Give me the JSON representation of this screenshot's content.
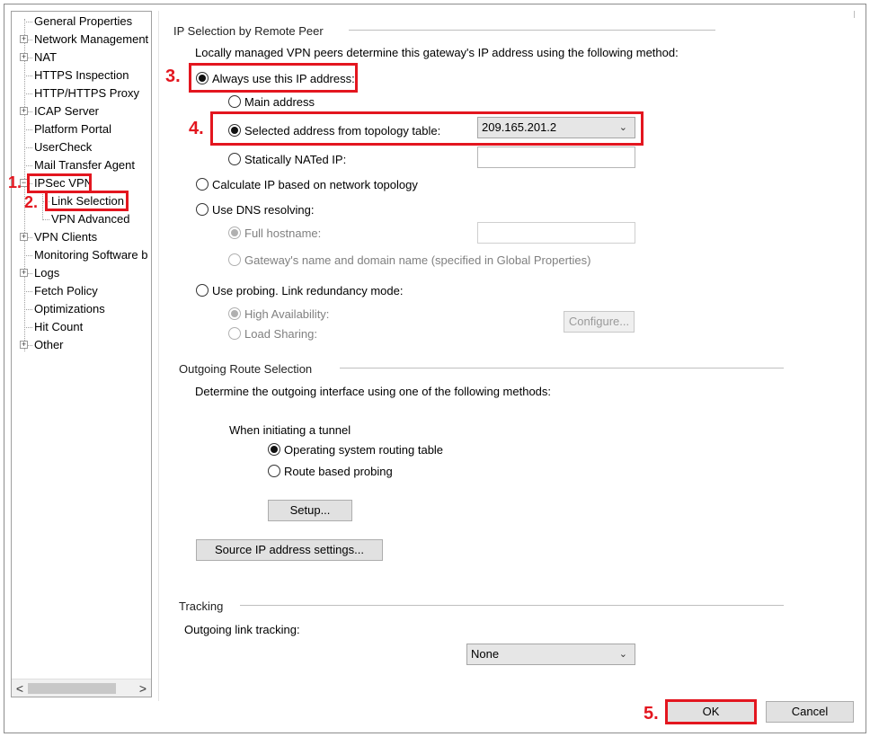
{
  "tree": {
    "items": [
      {
        "label": "General Properties",
        "expander": ""
      },
      {
        "label": "Network Management",
        "expander": "+"
      },
      {
        "label": "NAT",
        "expander": "+"
      },
      {
        "label": "HTTPS Inspection",
        "expander": ""
      },
      {
        "label": "HTTP/HTTPS Proxy",
        "expander": ""
      },
      {
        "label": "ICAP Server",
        "expander": "+"
      },
      {
        "label": "Platform Portal",
        "expander": ""
      },
      {
        "label": "UserCheck",
        "expander": ""
      },
      {
        "label": "Mail Transfer Agent",
        "expander": ""
      },
      {
        "label": "IPSec VPN",
        "expander": "−"
      },
      {
        "label": "Link Selection",
        "expander": ""
      },
      {
        "label": "VPN Advanced",
        "expander": ""
      },
      {
        "label": "VPN Clients",
        "expander": "+"
      },
      {
        "label": "Monitoring Software b",
        "expander": ""
      },
      {
        "label": "Logs",
        "expander": "+"
      },
      {
        "label": "Fetch Policy",
        "expander": ""
      },
      {
        "label": "Optimizations",
        "expander": ""
      },
      {
        "label": "Hit Count",
        "expander": ""
      },
      {
        "label": "Other",
        "expander": "+"
      }
    ],
    "scroll_left": "<",
    "scroll_right": ">"
  },
  "ip_selection": {
    "title": "IP Selection by Remote Peer",
    "description": "Locally managed VPN peers determine this gateway's IP address using the following method:",
    "always_use": "Always use this IP address:",
    "main_address": "Main address",
    "selected_from_topology": "Selected address from topology table:",
    "topology_value": "209.165.201.2",
    "statically_nated": "Statically NATed IP:",
    "calculate_ip": "Calculate IP based on network topology",
    "use_dns": "Use DNS resolving:",
    "full_hostname": "Full hostname:",
    "gateway_name": "Gateway's name and domain name (specified in Global Properties)",
    "use_probing": "Use probing. Link redundancy mode:",
    "high_availability": "High Availability:",
    "load_sharing": "Load Sharing:",
    "configure": "Configure..."
  },
  "outgoing": {
    "title": "Outgoing Route Selection",
    "description": "Determine the outgoing interface using one of the following methods:",
    "when_initiating": "When initiating a tunnel",
    "os_routing": "Operating system routing table",
    "route_probing": "Route based probing",
    "setup": "Setup...",
    "source_ip": "Source IP address settings..."
  },
  "tracking": {
    "title": "Tracking",
    "outgoing_link": "Outgoing link tracking:",
    "value": "None"
  },
  "buttons": {
    "ok": "OK",
    "cancel": "Cancel"
  },
  "steps": {
    "s1": "1.",
    "s2": "2.",
    "s3": "3.",
    "s4": "4.",
    "s5": "5."
  },
  "colors": {
    "annotation": "#e3161f"
  }
}
